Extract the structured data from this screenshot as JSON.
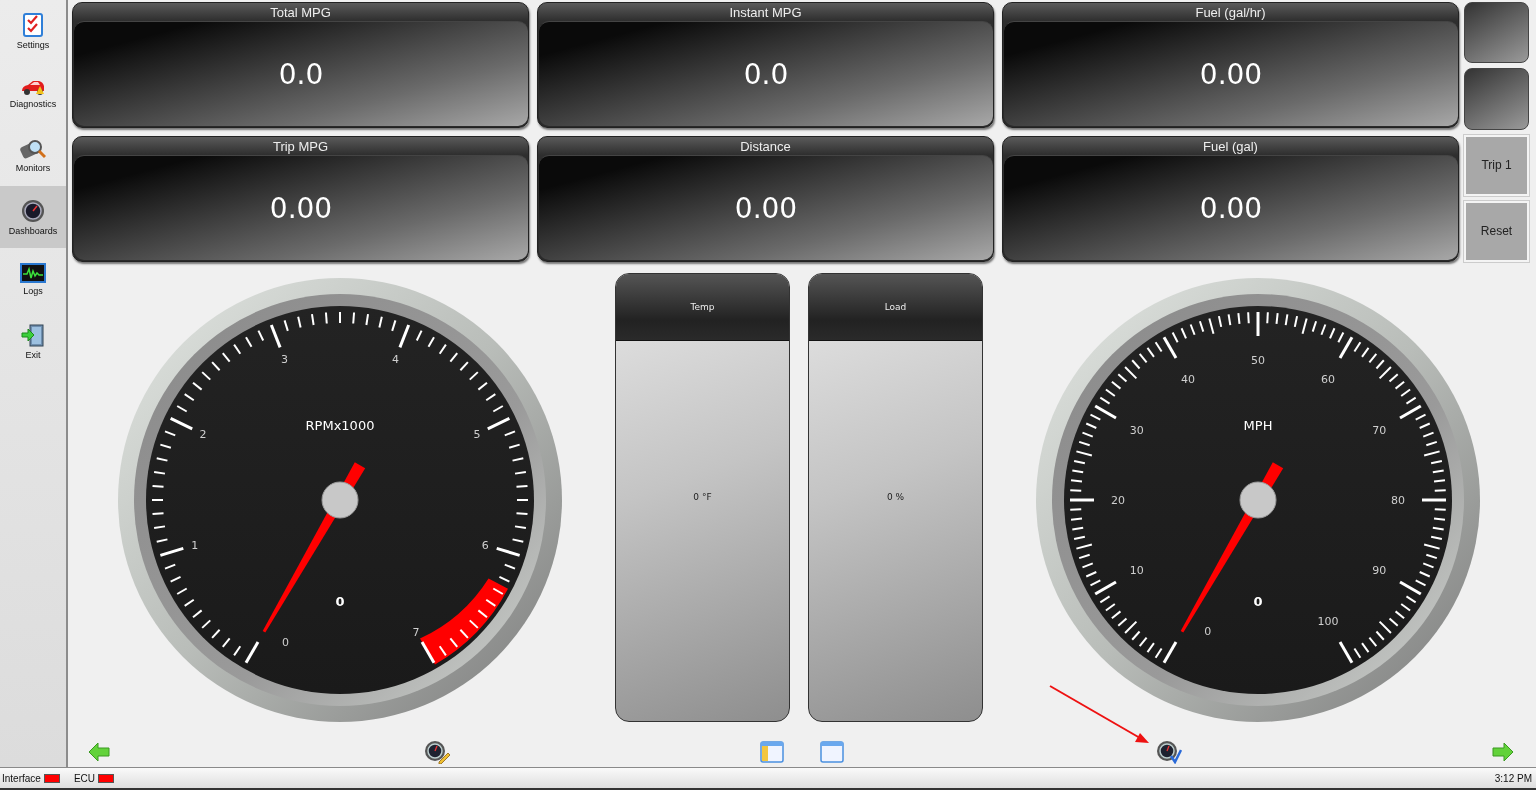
{
  "sidebar": {
    "items": [
      {
        "label": "Settings",
        "selected": false
      },
      {
        "label": "Diagnostics",
        "selected": false
      },
      {
        "label": "Monitors",
        "selected": false
      },
      {
        "label": "Dashboards",
        "selected": true
      },
      {
        "label": "Logs",
        "selected": false
      },
      {
        "label": "Exit",
        "selected": false
      }
    ]
  },
  "readouts": [
    {
      "title": "Total MPG",
      "value": "0.0"
    },
    {
      "title": "Instant MPG",
      "value": "0.0"
    },
    {
      "title": "Fuel (gal/hr)",
      "value": "0.00"
    },
    {
      "title": "Trip MPG",
      "value": "0.00"
    },
    {
      "title": "Distance",
      "value": "0.00"
    },
    {
      "title": "Fuel (gal)",
      "value": "0.00"
    }
  ],
  "side_buttons": [
    {
      "kind": "blank"
    },
    {
      "kind": "blank"
    },
    {
      "kind": "text",
      "label": "Trip 1"
    },
    {
      "kind": "text",
      "label": "Reset"
    }
  ],
  "gauges": [
    {
      "kind": "tachometer",
      "unit": "RPMx1000",
      "reading": "0",
      "tick_labels": [
        "0",
        "1",
        "2",
        "3",
        "4",
        "5",
        "6",
        "7"
      ]
    },
    {
      "kind": "speedometer",
      "unit": "MPH",
      "reading": "0",
      "tick_labels": [
        "0",
        "10",
        "20",
        "30",
        "40",
        "50",
        "60",
        "70",
        "80",
        "90",
        "100"
      ]
    }
  ],
  "bar_meters": [
    {
      "title": "Temp",
      "reading": "0 °F"
    },
    {
      "title": "Load",
      "reading": "0 %"
    }
  ],
  "status_bar": {
    "indicators": [
      {
        "label": "Interface",
        "color": "#ff0000"
      },
      {
        "label": "ECU",
        "color": "#ff0000"
      }
    ],
    "clock": "3:12 PM"
  }
}
